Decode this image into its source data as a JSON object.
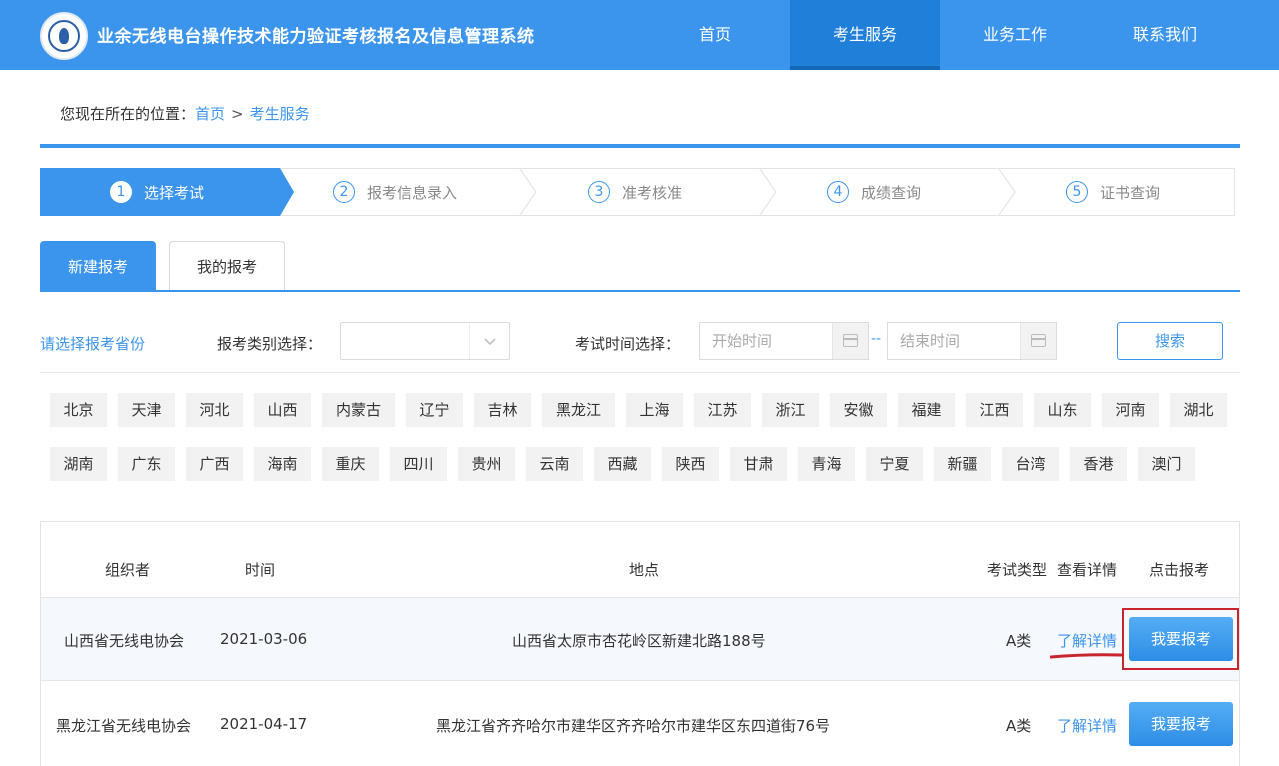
{
  "header": {
    "site_title": "业余无线电台操作技术能力验证考核报名及信息管理系统",
    "logo_icon": "radio-association-logo",
    "nav": [
      {
        "label": "首页",
        "active": false
      },
      {
        "label": "考生服务",
        "active": true
      },
      {
        "label": "业务工作",
        "active": false
      },
      {
        "label": "联系我们",
        "active": false
      }
    ],
    "brand_color": "#3c95ec"
  },
  "breadcrumb": {
    "prefix": "您现在所在的位置：",
    "home": "首页",
    "separator": ">",
    "current": "考生服务"
  },
  "steps": [
    {
      "num": "1",
      "label": "选择考试",
      "active": true
    },
    {
      "num": "2",
      "label": "报考信息录入",
      "active": false
    },
    {
      "num": "3",
      "label": "准考核准",
      "active": false
    },
    {
      "num": "4",
      "label": "成绩查询",
      "active": false
    },
    {
      "num": "5",
      "label": "证书查询",
      "active": false
    }
  ],
  "tabs": [
    {
      "label": "新建报考",
      "active": true
    },
    {
      "label": "我的报考",
      "active": false
    }
  ],
  "filters": {
    "province_prompt": "请选择报考省份",
    "category_label": "报考类别选择：",
    "category_value": "",
    "time_label": "考试时间选择：",
    "start_placeholder": "开始时间",
    "range_sep": "--",
    "end_placeholder": "结束时间",
    "search_label": "搜索"
  },
  "provinces": {
    "row1": [
      "北京",
      "天津",
      "河北",
      "山西",
      "内蒙古",
      "辽宁",
      "吉林",
      "黑龙江",
      "上海",
      "江苏",
      "浙江",
      "安徽",
      "福建",
      "江西",
      "山东",
      "河南",
      "湖北"
    ],
    "row2": [
      "湖南",
      "广东",
      "广西",
      "海南",
      "重庆",
      "四川",
      "贵州",
      "云南",
      "西藏",
      "陕西",
      "甘肃",
      "青海",
      "宁夏",
      "新疆",
      "台湾",
      "香港",
      "澳门"
    ]
  },
  "table": {
    "headers": {
      "organizer": "组织者",
      "time": "时间",
      "location": "地点",
      "type": "考试类型",
      "detail": "查看详情",
      "apply": "点击报考"
    },
    "rows": [
      {
        "organizer": "山西省无线电协会",
        "time": "2021-03-06",
        "location": "山西省太原市杏花岭区新建北路188号",
        "type": "A类",
        "detail": "了解详情",
        "apply": "我要报考"
      },
      {
        "organizer": "黑龙江省无线电协会",
        "time": "2021-04-17",
        "location": "黑龙江省齐齐哈尔市建华区齐齐哈尔市建华区东四道街76号",
        "type": "A类",
        "detail": "了解详情",
        "apply": "我要报考"
      }
    ]
  },
  "annotation_color": "#c9252d"
}
